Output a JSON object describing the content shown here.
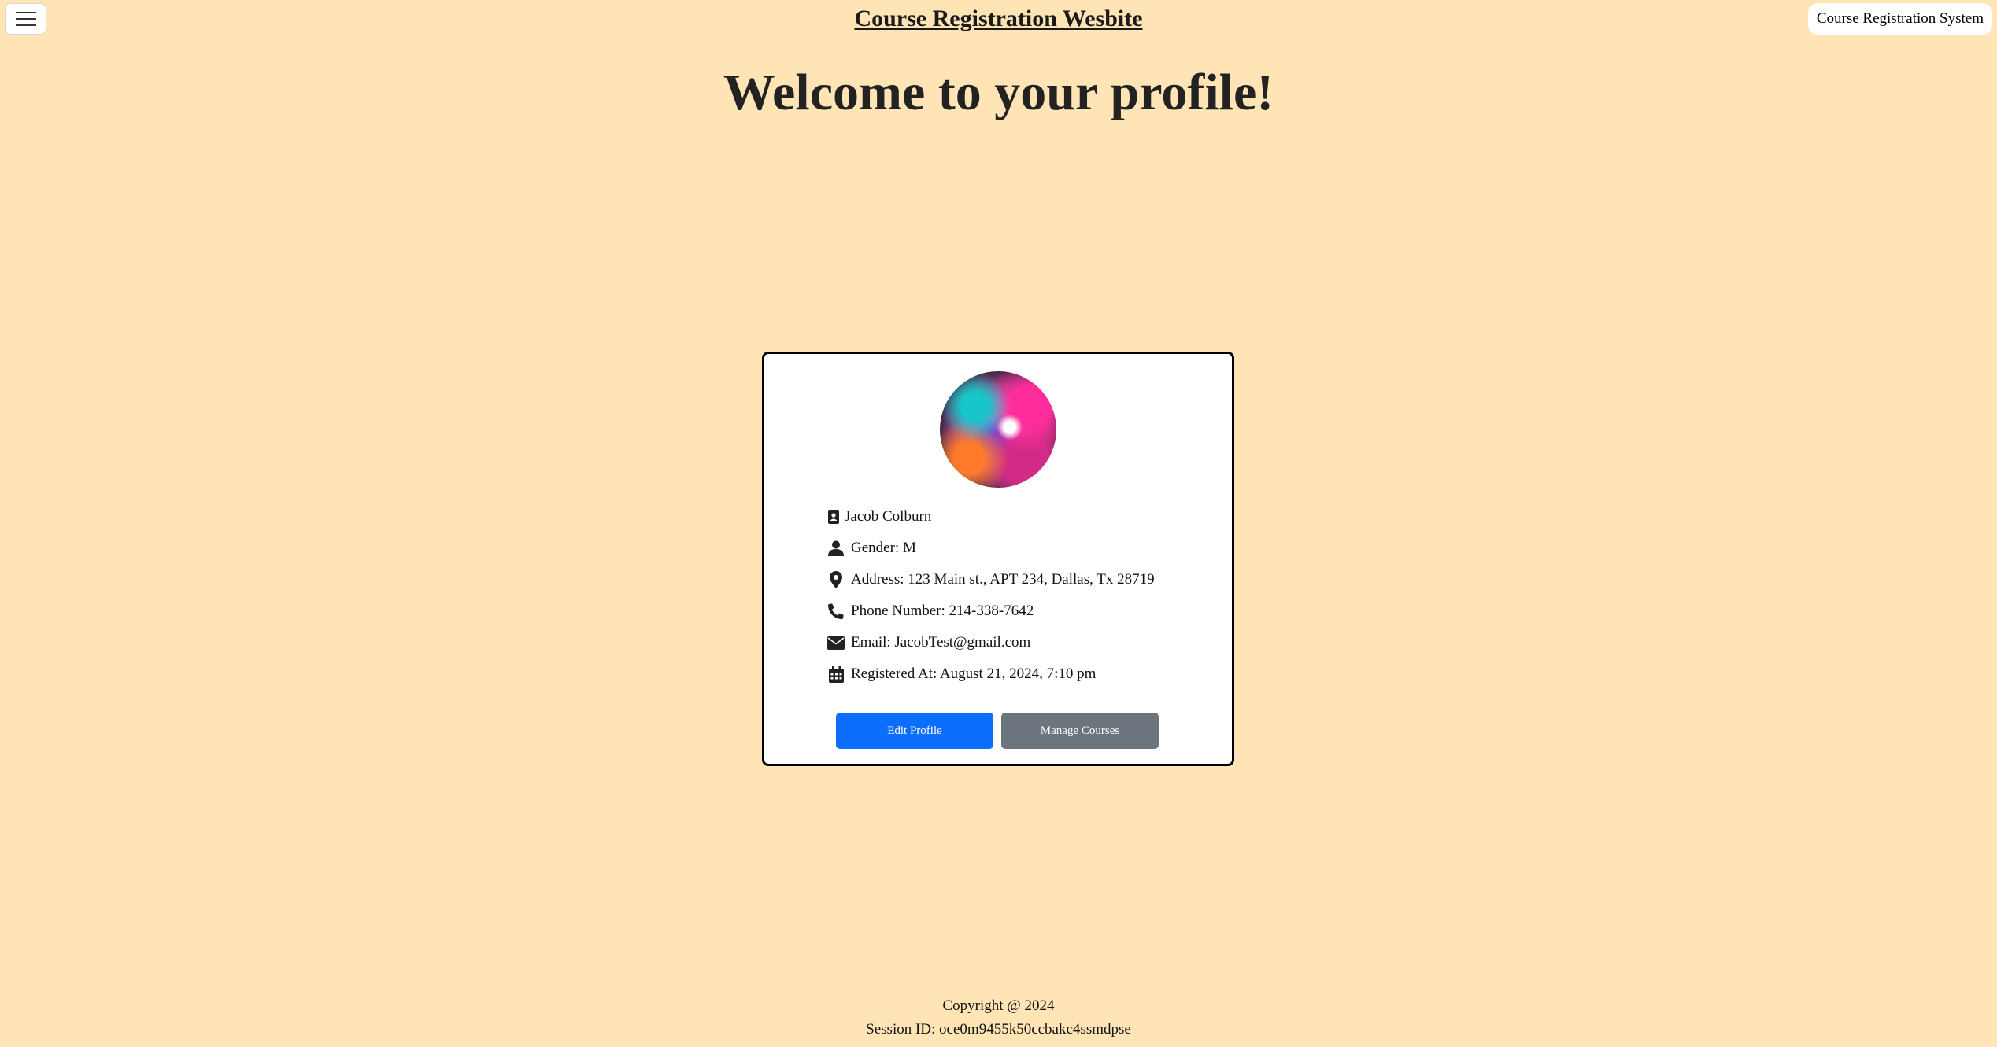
{
  "header": {
    "menu_icon": "hamburger-icon",
    "site_title": "Course Registration Wesbite",
    "brand": "Course Registration System"
  },
  "main": {
    "heading": "Welcome to your profile!"
  },
  "profile": {
    "avatar_alt": "profile picture",
    "name": "Jacob Colburn",
    "gender": "Gender: M",
    "address": "Address: 123 Main st., APT 234, Dallas, Tx 28719",
    "phone": "Phone Number: 214-338-7642",
    "email": "Email: JacobTest@gmail.com",
    "registered": "Registered At: August 21, 2024, 7:10 pm",
    "icons": {
      "name": "id-card-icon",
      "gender": "user-icon",
      "address": "map-pin-icon",
      "phone": "phone-icon",
      "email": "envelope-icon",
      "registered": "calendar-icon"
    }
  },
  "actions": {
    "edit_label": "Edit Profile",
    "manage_label": "Manage Courses"
  },
  "footer": {
    "copyright": "Copyright @ 2024",
    "session": "Session ID: oce0m9455k50ccbakc4ssmdpse"
  },
  "colors": {
    "background": "#ffe4b5",
    "primary": "#0d6efd",
    "secondary": "#6c757d"
  }
}
